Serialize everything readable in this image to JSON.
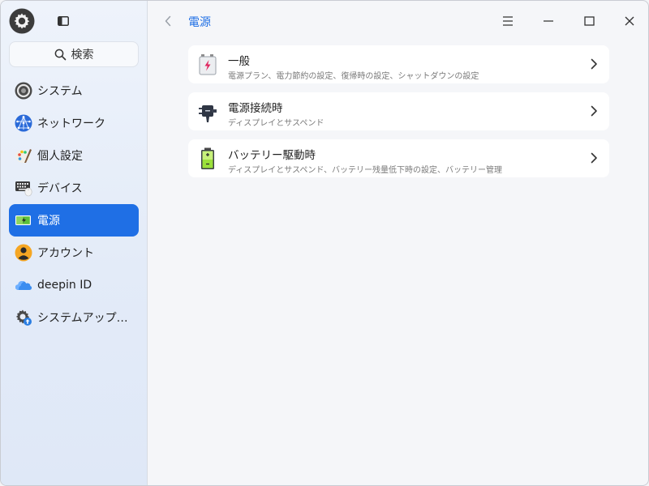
{
  "sidebar": {
    "search_label": "検索",
    "items": [
      {
        "label": "システム",
        "icon": "system-icon",
        "active": false
      },
      {
        "label": "ネットワーク",
        "icon": "network-icon",
        "active": false
      },
      {
        "label": "個人設定",
        "icon": "personalization-icon",
        "active": false
      },
      {
        "label": "デバイス",
        "icon": "devices-icon",
        "active": false
      },
      {
        "label": "電源",
        "icon": "power-icon",
        "active": true
      },
      {
        "label": "アカウント",
        "icon": "account-icon",
        "active": false
      },
      {
        "label": "deepin ID",
        "icon": "cloud-icon",
        "active": false
      },
      {
        "label": "システムアップ…",
        "icon": "system-update-icon",
        "active": false
      }
    ]
  },
  "header": {
    "title": "電源"
  },
  "cards": [
    {
      "title": "一般",
      "subtitle": "電源プラン、電力節約の設定、復帰時の設定、シャットダウンの設定",
      "icon": "battery-bolt-icon"
    },
    {
      "title": "電源接続時",
      "subtitle": "ディスプレイとサスペンド",
      "icon": "plug-icon"
    },
    {
      "title": "バッテリー駆動時",
      "subtitle": "ディスプレイとサスペンド、バッテリー残量低下時の設定、バッテリー管理",
      "icon": "battery-icon"
    }
  ],
  "colors": {
    "accent": "#1f6fe5",
    "sidebar_bg": "#e3ebf8",
    "card_bg": "#ffffff"
  }
}
